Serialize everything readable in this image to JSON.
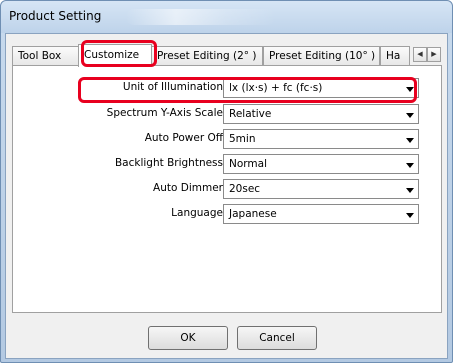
{
  "window": {
    "title": "Product Setting"
  },
  "tabs": [
    {
      "label": "Tool Box"
    },
    {
      "label": "Customize"
    },
    {
      "label": "Preset Editing (2° )"
    },
    {
      "label": "Preset Editing (10° )"
    },
    {
      "label": "Ha"
    }
  ],
  "tab_scroll": {
    "left_icon": "arrow-left-icon",
    "right_icon": "arrow-right-icon",
    "left_glyph": "◀",
    "right_glyph": "▶"
  },
  "settings": [
    {
      "label": "Unit of Illumination",
      "value": "lx (lx·s) + fc (fc·s)"
    },
    {
      "label": "Spectrum Y-Axis Scale",
      "value": "Relative"
    },
    {
      "label": "Auto Power Off",
      "value": "5min"
    },
    {
      "label": "Backlight Brightness",
      "value": "Normal"
    },
    {
      "label": "Auto Dimmer",
      "value": "20sec"
    },
    {
      "label": "Language",
      "value": "Japanese"
    }
  ],
  "buttons": {
    "ok": "OK",
    "cancel": "Cancel"
  },
  "colors": {
    "highlight": "#e8001f"
  }
}
